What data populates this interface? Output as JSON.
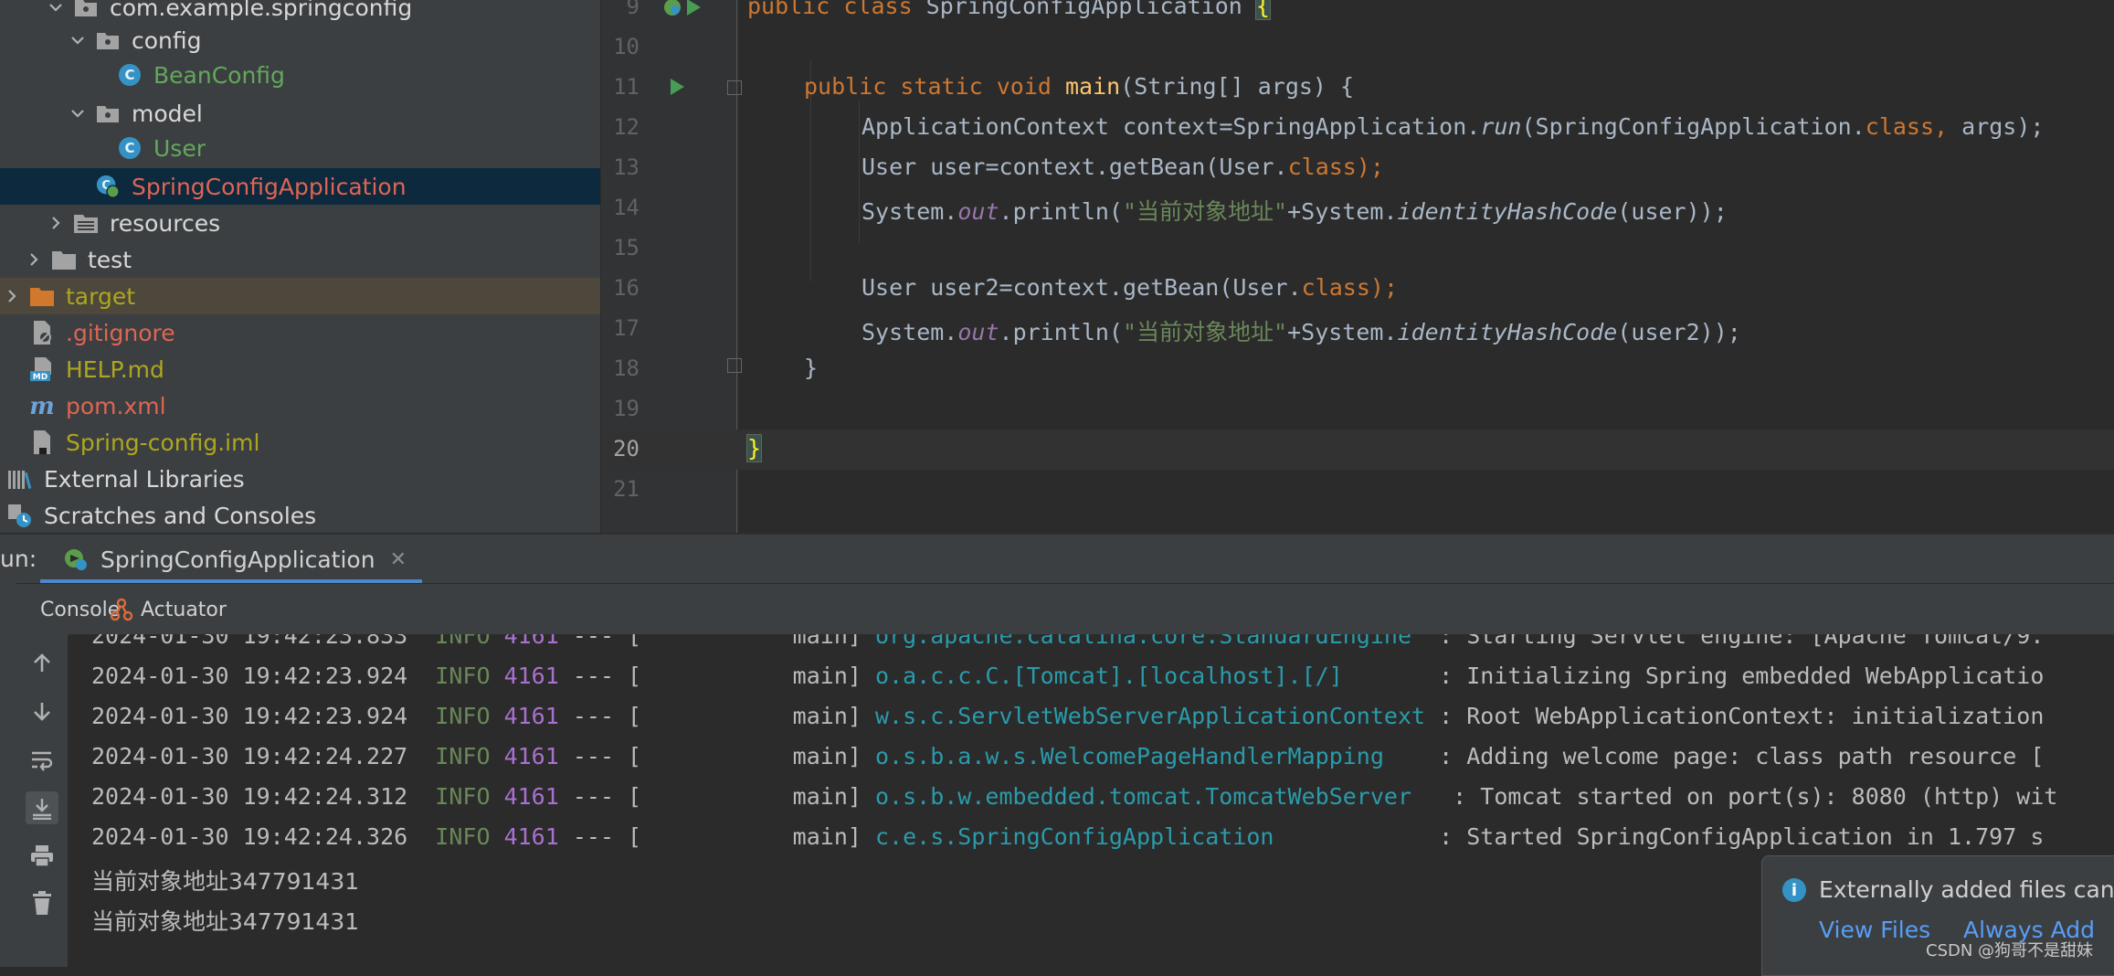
{
  "project_tree": [
    {
      "label": "com.example.springconfig",
      "color": "default",
      "icon": "package-icon",
      "expanded": true
    },
    {
      "label": "config",
      "color": "default",
      "icon": "package-icon",
      "expanded": true
    },
    {
      "label": "BeanConfig",
      "color": "green",
      "icon": "class-icon"
    },
    {
      "label": "model",
      "color": "default",
      "icon": "package-icon",
      "expanded": true
    },
    {
      "label": "User",
      "color": "green",
      "icon": "class-icon"
    },
    {
      "label": "SpringConfigApplication",
      "color": "red",
      "icon": "spring-boot-class-icon",
      "selected": true
    },
    {
      "label": "resources",
      "color": "default",
      "icon": "resources-folder-icon",
      "expanded": false
    },
    {
      "label": "test",
      "color": "default",
      "icon": "folder-icon",
      "expanded": false
    },
    {
      "label": "target",
      "color": "olive",
      "icon": "excluded-folder-icon",
      "expanded": false
    },
    {
      "label": ".gitignore",
      "color": "red",
      "icon": "ignore-file-icon"
    },
    {
      "label": "HELP.md",
      "color": "olive",
      "icon": "markdown-icon"
    },
    {
      "label": "pom.xml",
      "color": "red",
      "icon": "maven-icon"
    },
    {
      "label": "Spring-config.iml",
      "color": "olive",
      "icon": "iml-file-icon"
    },
    {
      "label": "External Libraries",
      "color": "default",
      "icon": "libraries-icon"
    },
    {
      "label": "Scratches and Consoles",
      "color": "default",
      "icon": "scratches-icon"
    }
  ],
  "editor": {
    "line_numbers": [
      "9",
      "10",
      "11",
      "12",
      "13",
      "14",
      "15",
      "16",
      "17",
      "18",
      "19",
      "20",
      "21"
    ],
    "lines": {
      "l9": {
        "kw": "public class ",
        "name": "SpringConfigApplication ",
        "brace": "{"
      },
      "l11": {
        "kw": "public static void ",
        "fn": "main",
        "rest": "(String[] args) {"
      },
      "l12": {
        "a": "ApplicationContext context=SpringApplication.",
        "b": "run",
        "c": "(SpringConfigApplication.",
        "d": "class",
        "e": ", ",
        "f": "args);"
      },
      "l13": {
        "a": "User user=context.getBean(User.",
        "b": "class",
        "c": ");"
      },
      "l14": {
        "a": "System.",
        "b": "out",
        "c": ".println(",
        "d": "\"当前对象地址\"",
        "e": "+System.",
        "f": "identityHashCode",
        "g": "(user));"
      },
      "l16": {
        "a": "User user2=context.getBean(User.",
        "b": "class",
        "c": ");"
      },
      "l17": {
        "a": "System.",
        "b": "out",
        "c": ".println(",
        "d": "\"当前对象地址\"",
        "e": "+System.",
        "f": "identityHashCode",
        "g": "(user2));"
      },
      "l18": {
        "a": "}"
      },
      "l20": {
        "brace": "}"
      }
    }
  },
  "run_window": {
    "prefix": "un:",
    "tab_label": "SpringConfigApplication",
    "subtabs": {
      "console": "Console",
      "actuator": "Actuator"
    }
  },
  "console_lines": [
    {
      "ts": "2024-01-30 19:42:23.833",
      "level": "INFO",
      "pid": "4161",
      "sep": " --- [",
      "thread": "           main]",
      "logger": "org.apache.catalina.core.StandardEngine ",
      "msg": " : Starting Servlet engine: [Apache Tomcat/9."
    },
    {
      "ts": "2024-01-30 19:42:23.924",
      "level": "INFO",
      "pid": "4161",
      "sep": " --- [",
      "thread": "           main]",
      "logger": "o.a.c.c.C.[Tomcat].[localhost].[/]      ",
      "msg": " : Initializing Spring embedded WebApplicatio"
    },
    {
      "ts": "2024-01-30 19:42:23.924",
      "level": "INFO",
      "pid": "4161",
      "sep": " --- [",
      "thread": "           main]",
      "logger": "w.s.c.ServletWebServerApplicationContext",
      "msg": " : Root WebApplicationContext: initialization"
    },
    {
      "ts": "2024-01-30 19:42:24.227",
      "level": "INFO",
      "pid": "4161",
      "sep": " --- [",
      "thread": "           main]",
      "logger": "o.s.b.a.w.s.WelcomePageHandlerMapping   ",
      "msg": " : Adding welcome page: class path resource ["
    },
    {
      "ts": "2024-01-30 19:42:24.312",
      "level": "INFO",
      "pid": "4161",
      "sep": " --- [",
      "thread": "           main]",
      "logger": "o.s.b.w.embedded.tomcat.TomcatWebServer  ",
      "msg": " : Tomcat started on port(s): 8080 (http) wit"
    },
    {
      "ts": "2024-01-30 19:42:24.326",
      "level": "INFO",
      "pid": "4161",
      "sep": " --- [",
      "thread": "           main]",
      "logger": "c.e.s.SpringConfigApplication           ",
      "msg": " : Started SpringConfigApplication in 1.797 s"
    }
  ],
  "console_output": [
    "当前对象地址347791431",
    "当前对象地址347791431"
  ],
  "notification": {
    "text": "Externally added files can",
    "link_view": "View Files",
    "link_always": "Always Add"
  },
  "watermark": "CSDN @狗哥不是甜妹",
  "colors": {
    "accent": "#4a88c7",
    "selection": "#0d293e",
    "keyword": "#cc7832",
    "string": "#6a8759",
    "logger": "#2a9bab"
  }
}
